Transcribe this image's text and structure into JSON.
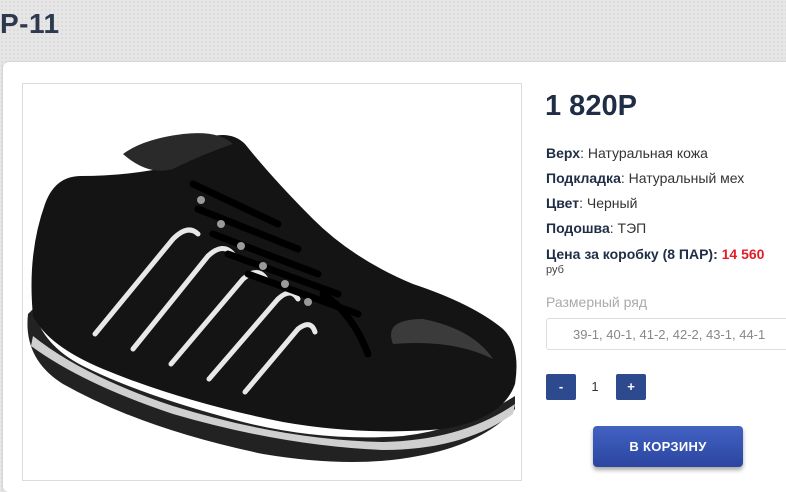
{
  "product": {
    "title": "P-11",
    "price": "1 820Р",
    "specs": [
      {
        "label": "Верх",
        "value": "Натуральная кожа"
      },
      {
        "label": "Подкладка",
        "value": "Натуральный мех"
      },
      {
        "label": "Цвет",
        "value": "Черный"
      },
      {
        "label": "Подошва",
        "value": "ТЭП"
      }
    ],
    "box_price_label": "Цена за коробку (8 ПАР):",
    "box_price_value": "14 560",
    "currency": "руб"
  },
  "sizes": {
    "label": "Размерный ряд",
    "selected": "39-1, 40-1, 41-2, 42-2, 43-1, 44-1"
  },
  "quantity": {
    "minus_label": "-",
    "value": "1",
    "plus_label": "+"
  },
  "cart": {
    "button_label": "В КОРЗИНУ"
  },
  "colors": {
    "accent": "#2e4a8e",
    "price_red": "#e11d2a",
    "title": "#2d3a4d"
  }
}
